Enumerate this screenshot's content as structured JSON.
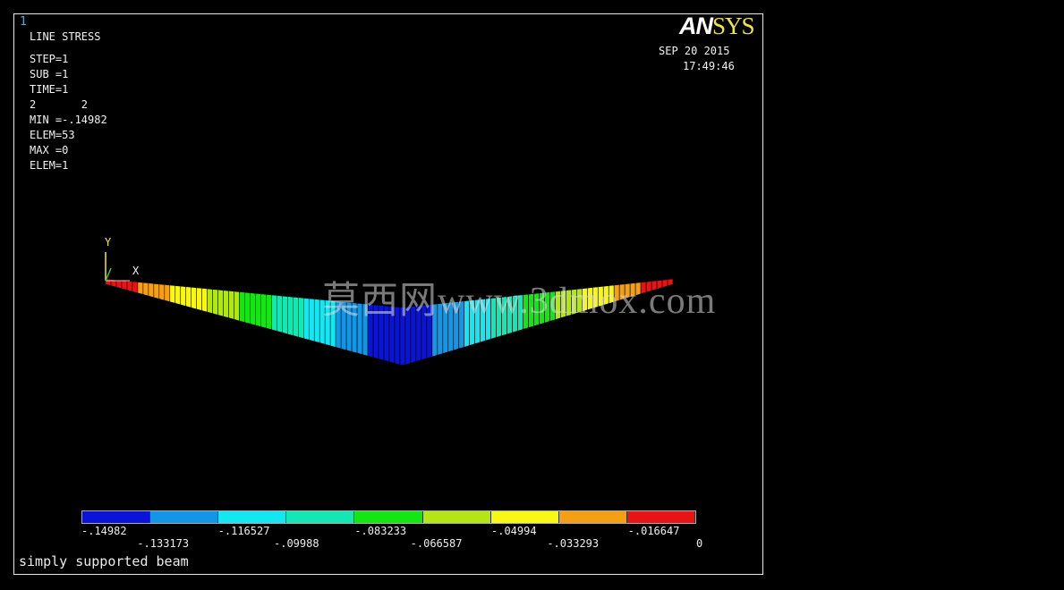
{
  "window_number": "1",
  "logo": {
    "an": "AN",
    "sys": "SYS"
  },
  "info": {
    "title": "LINE STRESS",
    "step": "STEP=1",
    "sub": "SUB =1",
    "time": "TIME=1",
    "items": "2       2",
    "min": "MIN =-.14982",
    "min_elem": "ELEM=53",
    "max": "MAX =0",
    "max_elem": "ELEM=1"
  },
  "date": "SEP 20 2015",
  "clock": "17:49:46",
  "axes": {
    "y": "Y",
    "x": "X"
  },
  "legend": {
    "colors": [
      "#0a14d8",
      "#1496e6",
      "#14e6f2",
      "#14e6b4",
      "#14e614",
      "#b4e614",
      "#f8f814",
      "#f5a014",
      "#e61414"
    ],
    "labels_top": [
      "-.14982",
      "-.116527",
      "-.083233",
      "-.04994",
      "-.016647"
    ],
    "labels_bottom": [
      "-.133173",
      "-.09988",
      "-.066587",
      "-.033293",
      "0"
    ]
  },
  "beam": {
    "element_count": 106,
    "min_value": -0.14982,
    "max_value": 0
  },
  "watermark": "莫西网www.3dmox.com",
  "footer": "simply supported beam"
}
